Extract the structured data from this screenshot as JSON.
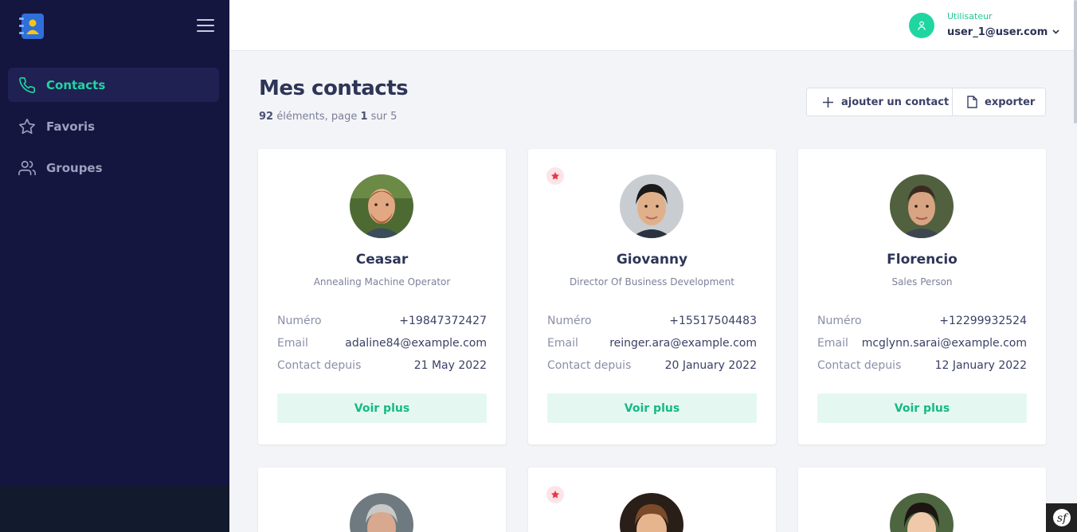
{
  "sidebar": {
    "items": [
      {
        "label": "Contacts",
        "icon": "phone-icon",
        "active": true
      },
      {
        "label": "Favoris",
        "icon": "star-icon",
        "active": false
      },
      {
        "label": "Groupes",
        "icon": "users-icon",
        "active": false
      }
    ]
  },
  "header": {
    "role": "Utilisateur",
    "username": "user_1@user.com"
  },
  "main": {
    "title": "Mes contacts",
    "count": "92",
    "count_suffix": " éléments, page ",
    "page": "1",
    "page_sep": " sur ",
    "total_pages": "5",
    "add_label": "ajouter un contact",
    "export_label": "exporter"
  },
  "labels": {
    "number": "Numéro",
    "email": "Email",
    "since": "Contact depuis",
    "more": "Voir plus"
  },
  "contacts": [
    {
      "name": "Ceasar",
      "job": "Annealing Machine Operator",
      "phone": "+19847372427",
      "email": "adaline84@example.com",
      "since": "21 May 2022",
      "favorite": false
    },
    {
      "name": "Giovanny",
      "job": "Director Of Business Development",
      "phone": "+15517504483",
      "email": "reinger.ara@example.com",
      "since": "20 January 2022",
      "favorite": true
    },
    {
      "name": "Florencio",
      "job": "Sales Person",
      "phone": "+12299932524",
      "email": "mcglynn.sarai@example.com",
      "since": "12 January 2022",
      "favorite": false
    },
    {
      "favorite": false
    },
    {
      "favorite": true
    },
    {
      "favorite": false
    }
  ],
  "colors": {
    "sidebar": "#141640",
    "accent": "#1fd6a1",
    "favorite": "#e53945"
  }
}
